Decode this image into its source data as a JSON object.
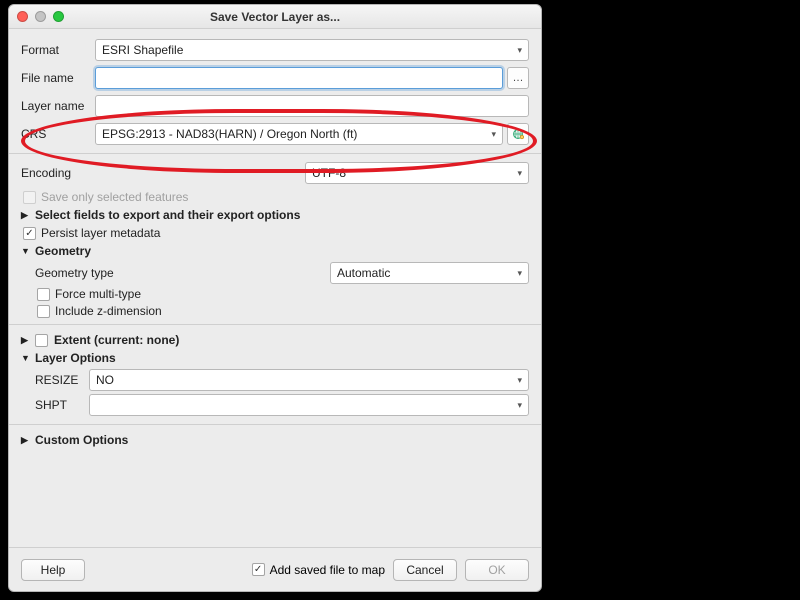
{
  "window": {
    "title": "Save Vector Layer as..."
  },
  "form": {
    "format": {
      "label": "Format",
      "value": "ESRI Shapefile"
    },
    "file_name": {
      "label": "File name",
      "value": "",
      "browse": "…"
    },
    "layer_name": {
      "label": "Layer name",
      "value": ""
    },
    "crs": {
      "label": "CRS",
      "value": "EPSG:2913 - NAD83(HARN) / Oregon North (ft)"
    }
  },
  "encoding": {
    "label": "Encoding",
    "value": "UTF-8"
  },
  "save_selected": {
    "label": "Save only selected features",
    "checked": false,
    "enabled": false
  },
  "fields_section": {
    "label": "Select fields to export and their export options",
    "expanded": false
  },
  "persist_meta": {
    "label": "Persist layer metadata",
    "checked": true
  },
  "geometry": {
    "label": "Geometry",
    "type": {
      "label": "Geometry type",
      "value": "Automatic"
    },
    "force_multi": {
      "label": "Force multi-type",
      "checked": false
    },
    "include_z": {
      "label": "Include z-dimension",
      "checked": false
    }
  },
  "extent": {
    "label": "Extent (current: none)",
    "checked": false,
    "expanded": false
  },
  "layer_options": {
    "label": "Layer Options",
    "resize": {
      "label": "RESIZE",
      "value": "NO"
    },
    "shpt": {
      "label": "SHPT",
      "value": ""
    }
  },
  "custom_options": {
    "label": "Custom Options",
    "expanded": false
  },
  "footer": {
    "help": "Help",
    "add_to_map": {
      "label": "Add saved file to map",
      "checked": true
    },
    "cancel": "Cancel",
    "ok": "OK"
  }
}
